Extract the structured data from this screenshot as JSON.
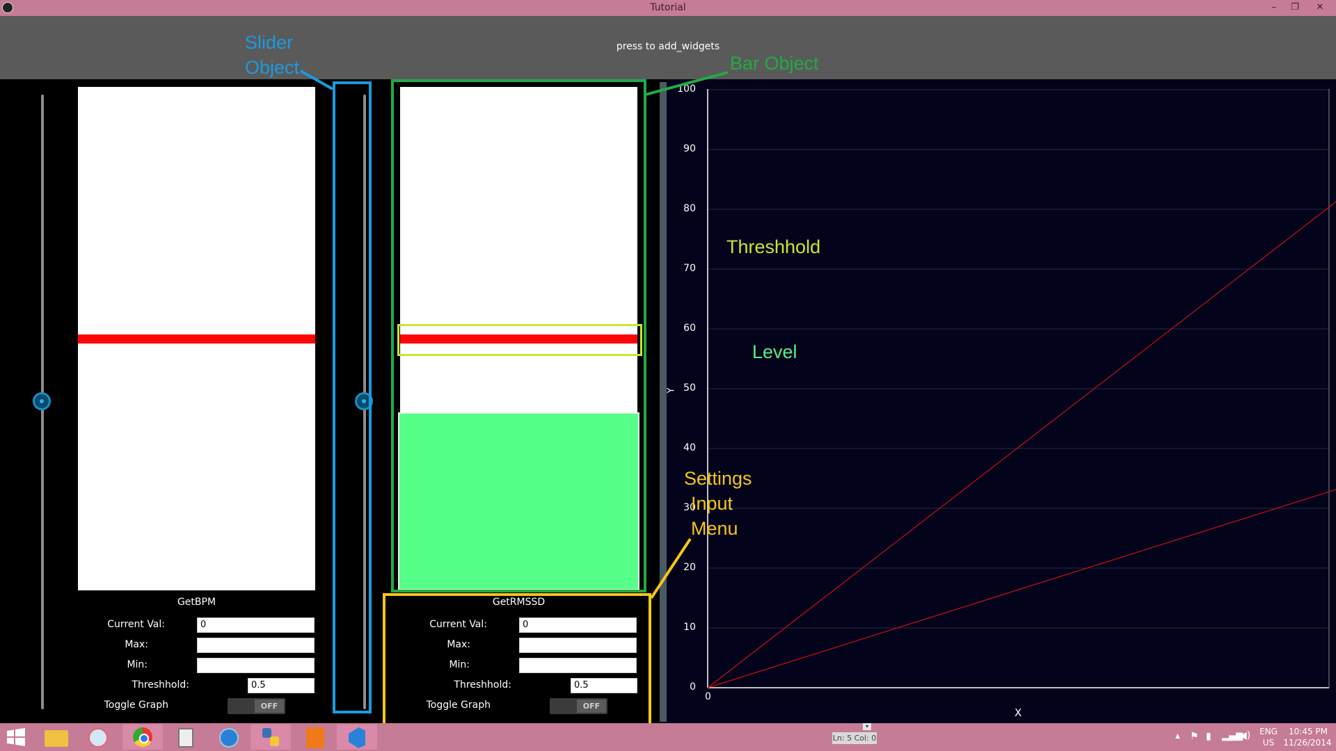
{
  "window": {
    "title": "Tutorial",
    "controls": [
      "–",
      "❐",
      "✕"
    ]
  },
  "header": {
    "button_label": "press to add_widgets"
  },
  "widgets": [
    {
      "name": "GetBPM",
      "current_val_label": "Current Val:",
      "current_val": "0",
      "max_label": "Max:",
      "max": "",
      "min_label": "Min:",
      "min": "",
      "threshold_label": "Threshhold:",
      "threshold": "0.5",
      "toggle_label": "Toggle Graph",
      "toggle_state": "OFF",
      "slider_value": 0.5,
      "level_value": 0,
      "threshold_line": 0.5
    },
    {
      "name": "GetRMSSD",
      "current_val_label": "Current Val:",
      "current_val": "0",
      "max_label": "Max:",
      "max": "",
      "min_label": "Min:",
      "min": "",
      "threshold_label": "Threshhold:",
      "threshold": "0.5",
      "toggle_label": "Toggle Graph",
      "toggle_state": "OFF",
      "slider_value": 0.5,
      "level_value": 0.35,
      "threshold_line": 0.5
    }
  ],
  "annotations": {
    "slider": [
      "Slider",
      "Object"
    ],
    "bar": "Bar Object",
    "threshold": "Threshhold",
    "level": "Level",
    "settings": [
      "Settings",
      "Input",
      "Menu"
    ],
    "colors": {
      "slider": "#1a9be0",
      "bar": "#22aa44",
      "threshold": "#c8e632",
      "level": "#55ee88",
      "settings": "#f5c518"
    }
  },
  "graph": {
    "xlabel": "X",
    "ylabel": "Y",
    "x_tick": "0",
    "y_ticks": [
      "0",
      "10",
      "20",
      "30",
      "40",
      "50",
      "60",
      "70",
      "80",
      "90",
      "100"
    ],
    "colors": {
      "background": "#03031b",
      "line": "#cc1010",
      "grid": "#2a2a40"
    }
  },
  "taskbar": {
    "icons": [
      "windows-start-icon",
      "file-explorer-icon",
      "paint-icon",
      "chrome-icon",
      "calculator-icon",
      "browser-globe-icon",
      "python-icon",
      "pdf-icon",
      "visual-studio-icon"
    ],
    "status": "Ln: 5 Col: 0",
    "lang": "ENG",
    "region": "US",
    "time": "10:45 PM",
    "date": "11/26/2014"
  }
}
